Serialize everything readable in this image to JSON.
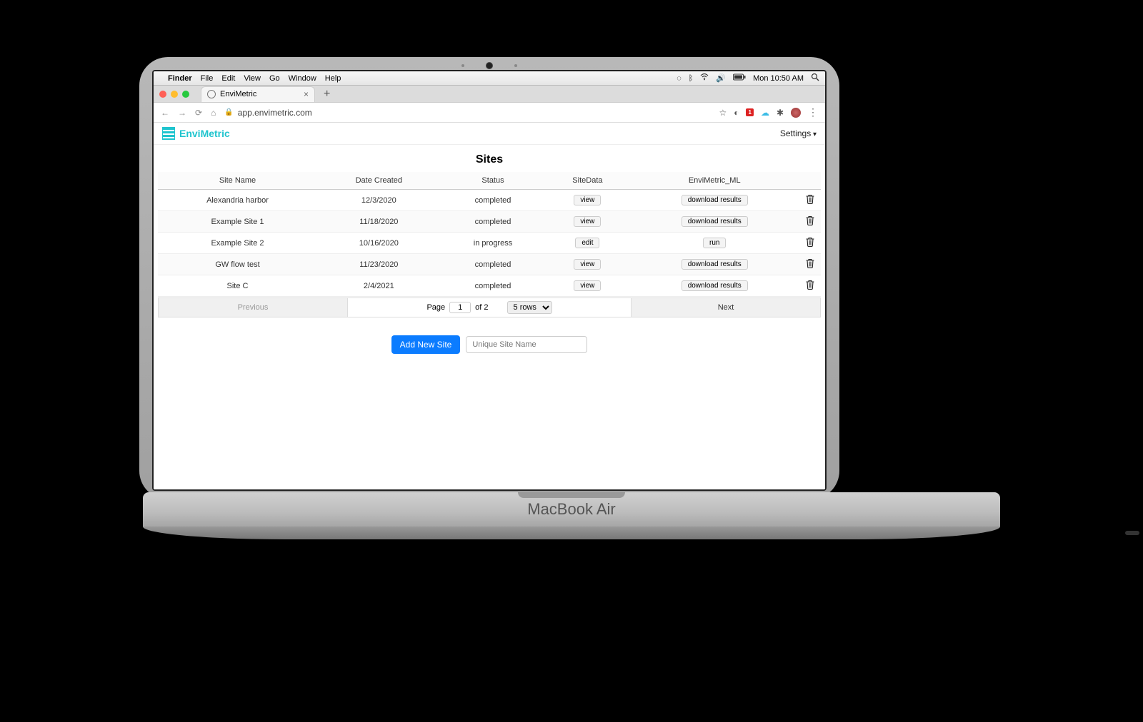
{
  "mac_menubar": {
    "app": "Finder",
    "items": [
      "File",
      "Edit",
      "View",
      "Go",
      "Window",
      "Help"
    ],
    "clock": "Mon 10:50 AM"
  },
  "browser": {
    "tab_title": "EnviMetric",
    "address": "app.envimetric.com"
  },
  "app": {
    "brand": "EnviMetric",
    "settings_label": "Settings",
    "page_title": "Sites",
    "columns": {
      "name": "Site Name",
      "date": "Date Created",
      "status": "Status",
      "site_data": "SiteData",
      "ml": "EnviMetric_ML"
    },
    "rows": [
      {
        "name": "Alexandria harbor",
        "date": "12/3/2020",
        "status": "completed",
        "site_data_btn": "view",
        "ml_btn": "download results"
      },
      {
        "name": "Example Site 1",
        "date": "11/18/2020",
        "status": "completed",
        "site_data_btn": "view",
        "ml_btn": "download results"
      },
      {
        "name": "Example Site 2",
        "date": "10/16/2020",
        "status": "in progress",
        "site_data_btn": "edit",
        "ml_btn": "run"
      },
      {
        "name": "GW flow test",
        "date": "11/23/2020",
        "status": "completed",
        "site_data_btn": "view",
        "ml_btn": "download results"
      },
      {
        "name": "Site C",
        "date": "2/4/2021",
        "status": "completed",
        "site_data_btn": "view",
        "ml_btn": "download results"
      }
    ],
    "pagination": {
      "prev": "Previous",
      "next": "Next",
      "page_label": "Page",
      "page_current": "1",
      "of_label": "of 2",
      "rows_selected": "5 rows"
    },
    "add": {
      "button_label": "Add New Site",
      "placeholder": "Unique Site Name"
    }
  }
}
